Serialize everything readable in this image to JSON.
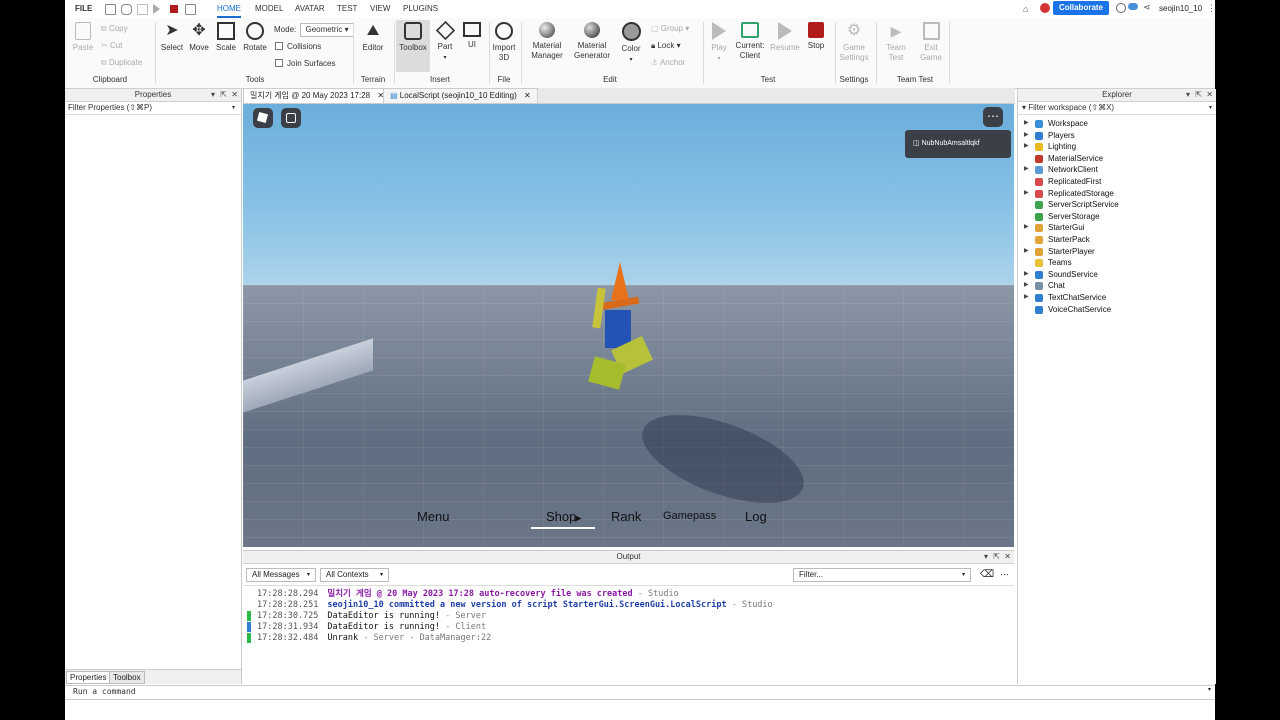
{
  "menubar": {
    "file": "FILE",
    "tabs": [
      "HOME",
      "MODEL",
      "AVATAR",
      "TEST",
      "VIEW",
      "PLUGINS"
    ],
    "collaborate": "Collaborate",
    "username": "seojin10_10"
  },
  "ribbon": {
    "clipboard": {
      "paste": "Paste",
      "copy": "Copy",
      "cut": "Cut",
      "duplicate": "Duplicate",
      "label": "Clipboard"
    },
    "tools": {
      "select": "Select",
      "move": "Move",
      "scale": "Scale",
      "rotate": "Rotate",
      "mode_label": "Mode:",
      "mode_value": "Geometric",
      "collisions": "Collisions",
      "join_surfaces": "Join Surfaces",
      "label": "Tools"
    },
    "terrain": {
      "editor": "Editor",
      "label": "Terrain"
    },
    "insert": {
      "toolbox": "Toolbox",
      "part": "Part",
      "ui": "UI",
      "label": "Insert"
    },
    "file": {
      "import3d_line1": "Import",
      "import3d_line2": "3D",
      "label": "File"
    },
    "edit": {
      "material_manager_1": "Material",
      "material_manager_2": "Manager",
      "material_generator_1": "Material",
      "material_generator_2": "Generator",
      "color": "Color",
      "group": "Group",
      "lock": "Lock",
      "anchor": "Anchor",
      "label": "Edit"
    },
    "test": {
      "play": "Play",
      "current_client_1": "Current:",
      "current_client_2": "Client",
      "resume": "Resume",
      "stop": "Stop",
      "label": "Test"
    },
    "settings": {
      "game_settings_1": "Game",
      "game_settings_2": "Settings",
      "label": "Settings"
    },
    "team_test": {
      "team_test_1": "Team",
      "team_test_2": "Test",
      "exit_game_1": "Exit",
      "exit_game_2": "Game",
      "label": "Team Test"
    }
  },
  "properties": {
    "title": "Properties",
    "filter_placeholder": "Filter Properties (⇧⌘P)"
  },
  "doc_tabs": [
    "밀치기 게임 @ 20 May 2023 17:28",
    "LocalScript (seojin10_10 Editing)"
  ],
  "viewport": {
    "player_name": "NubNubAmsaltlqkf",
    "gui_buttons": [
      "Menu",
      "Shop",
      "Rank",
      "Gamepass",
      "Log"
    ]
  },
  "explorer": {
    "title": "Explorer",
    "filter_placeholder": "Filter workspace (⇧⌘X)",
    "items": [
      {
        "label": "Workspace",
        "color": "#3a8fd8",
        "expandable": true
      },
      {
        "label": "Players",
        "color": "#2f7fd0",
        "expandable": true
      },
      {
        "label": "Lighting",
        "color": "#e8b923",
        "expandable": true
      },
      {
        "label": "MaterialService",
        "color": "#c0392b",
        "expandable": false
      },
      {
        "label": "NetworkClient",
        "color": "#5a9bd5",
        "expandable": true
      },
      {
        "label": "ReplicatedFirst",
        "color": "#d84b4b",
        "expandable": false
      },
      {
        "label": "ReplicatedStorage",
        "color": "#d84b4b",
        "expandable": true
      },
      {
        "label": "ServerScriptService",
        "color": "#3fa34d",
        "expandable": false
      },
      {
        "label": "ServerStorage",
        "color": "#3fa34d",
        "expandable": false
      },
      {
        "label": "StarterGui",
        "color": "#e0a33a",
        "expandable": true
      },
      {
        "label": "StarterPack",
        "color": "#e0a33a",
        "expandable": false
      },
      {
        "label": "StarterPlayer",
        "color": "#e0a33a",
        "expandable": true
      },
      {
        "label": "Teams",
        "color": "#e8c23a",
        "expandable": false
      },
      {
        "label": "SoundService",
        "color": "#2f7fd0",
        "expandable": true
      },
      {
        "label": "Chat",
        "color": "#7a8fa6",
        "expandable": true
      },
      {
        "label": "TextChatService",
        "color": "#2f7fd0",
        "expandable": true
      },
      {
        "label": "VoiceChatService",
        "color": "#2f7fd0",
        "expandable": false
      }
    ]
  },
  "output": {
    "title": "Output",
    "messages_filter": "All Messages",
    "contexts_filter": "All Contexts",
    "search_placeholder": "Filter...",
    "logs": [
      {
        "time": "17:28:28.294",
        "text": "밀치기 게임 @ 20 May 2023 17:28 auto-recovery file was created",
        "source": "Studio",
        "color": "#8a1aa3",
        "bar": ""
      },
      {
        "time": "17:28:28.251",
        "text": "seojin10_10 committed a new version of script StarterGui.ScreenGui.LocalScript",
        "source": "Studio",
        "color": "#1f3fa8",
        "bar": ""
      },
      {
        "time": "17:28:30.725",
        "text": "DataEditor is running!",
        "source": "Server",
        "color": "#111111",
        "bar": "#2fb84a"
      },
      {
        "time": "17:28:31.934",
        "text": "DataEditor is running!",
        "source": "Client",
        "color": "#111111",
        "bar": "#2f7fd0"
      },
      {
        "time": "17:28:32.484",
        "text": "Unrank",
        "source": "Server - DataManager:22",
        "color": "#111111",
        "bar": "#2fb84a"
      }
    ]
  },
  "bottom_tabs": [
    "Properties",
    "Toolbox"
  ],
  "command_bar": {
    "placeholder": "Run a command"
  }
}
